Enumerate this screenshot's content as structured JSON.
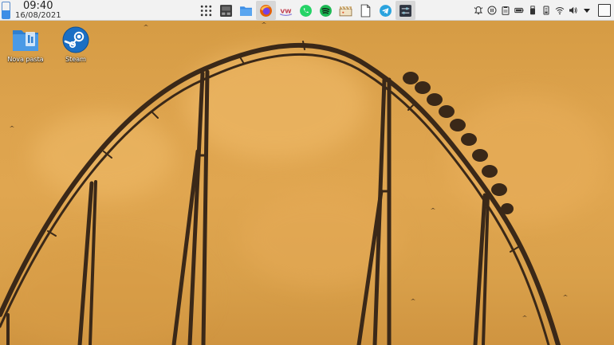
{
  "panel": {
    "clock": {
      "time": "09:40",
      "date": "16/08/2021"
    },
    "taskbar_apps": [
      {
        "name": "app-launcher",
        "icon": "grid-icon"
      },
      {
        "name": "system-monitor",
        "icon": "monitor-icon"
      },
      {
        "name": "file-manager",
        "icon": "folder-icon"
      },
      {
        "name": "firefox",
        "icon": "firefox-icon"
      },
      {
        "name": "vivaldi",
        "icon": "vivaldi-icon"
      },
      {
        "name": "whatsapp",
        "icon": "whatsapp-icon"
      },
      {
        "name": "spotify",
        "icon": "spotify-icon"
      },
      {
        "name": "video-editor",
        "icon": "clapperboard-icon"
      },
      {
        "name": "text-document",
        "icon": "document-icon"
      },
      {
        "name": "telegram",
        "icon": "telegram-icon"
      },
      {
        "name": "settings",
        "icon": "sliders-icon"
      }
    ],
    "tray": [
      "notifications-icon",
      "media-player-icon",
      "clipboard-icon",
      "battery-icon",
      "usb-device-icon",
      "storage-icon",
      "wifi-icon",
      "volume-icon",
      "tray-expand-icon"
    ]
  },
  "desktop": {
    "icons": [
      {
        "label": "Nova pasta",
        "icon": "folder-icon"
      },
      {
        "label": "Steam",
        "icon": "steam-icon"
      }
    ]
  },
  "colors": {
    "sky": "#dca24c",
    "silhouette": "#3a2818",
    "panel": "#f2f2f2",
    "accent": "#3d8ee6"
  }
}
